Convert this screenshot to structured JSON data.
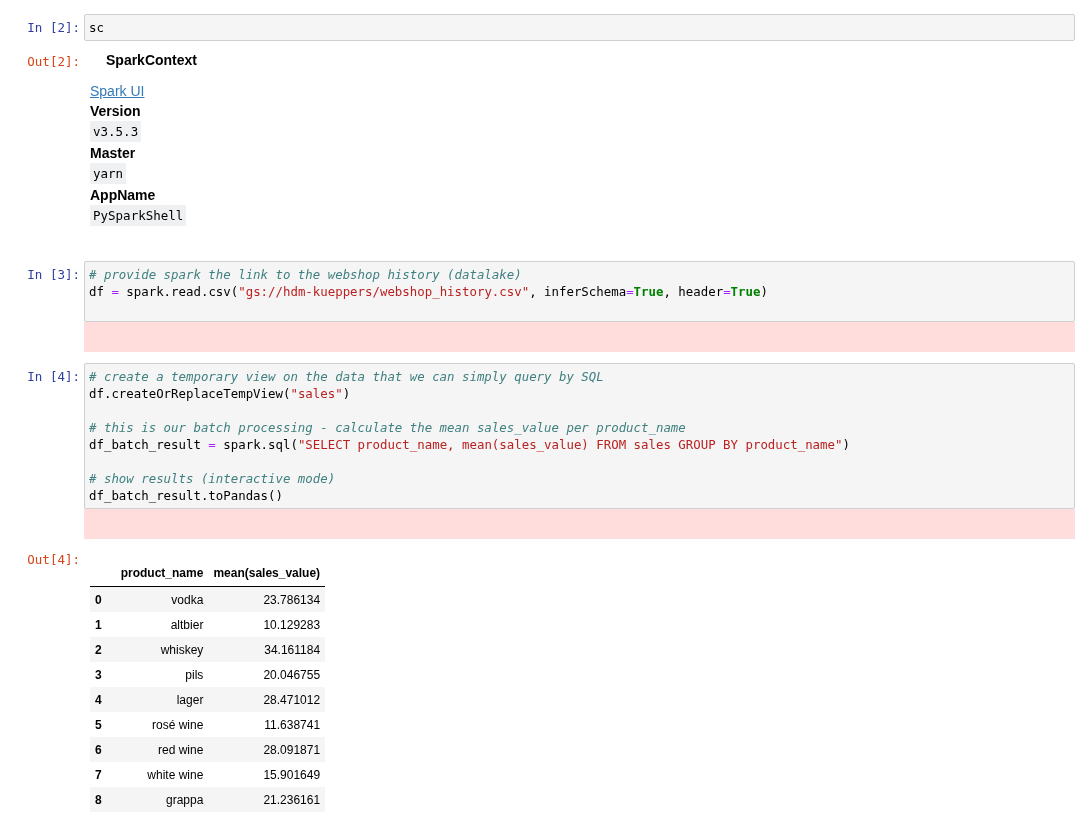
{
  "cells": [
    {
      "kind": "code",
      "prompt": "In [2]:",
      "tokens": [
        {
          "text": "sc",
          "kind": "plain"
        }
      ],
      "trailing_blank": false,
      "stderr": false
    },
    {
      "kind": "spark_context",
      "prompt": "Out[2]:",
      "title": "SparkContext",
      "link": "Spark UI",
      "fields": [
        {
          "label": "Version",
          "value": "v3.5.3"
        },
        {
          "label": "Master",
          "value": "yarn"
        },
        {
          "label": "AppName",
          "value": "PySparkShell"
        }
      ]
    },
    {
      "kind": "code",
      "prompt": "In [3]:",
      "tokens": [
        {
          "text": "# provide spark the link to the webshop history (datalake)",
          "kind": "comment"
        },
        {
          "text": "\ndf ",
          "kind": "plain"
        },
        {
          "text": "=",
          "kind": "op"
        },
        {
          "text": " spark.read.csv(",
          "kind": "plain"
        },
        {
          "text": "\"gs://hdm-kueppers/webshop_history.csv\"",
          "kind": "string"
        },
        {
          "text": ", inferSchema",
          "kind": "plain"
        },
        {
          "text": "=",
          "kind": "op"
        },
        {
          "text": "True",
          "kind": "keyword"
        },
        {
          "text": ", header",
          "kind": "plain"
        },
        {
          "text": "=",
          "kind": "op"
        },
        {
          "text": "True",
          "kind": "keyword"
        },
        {
          "text": ")",
          "kind": "plain"
        }
      ],
      "trailing_blank": true,
      "stderr": true
    },
    {
      "kind": "code",
      "prompt": "In [4]:",
      "tokens": [
        {
          "text": "# create a temporary view on the data that we can simply query by SQL",
          "kind": "comment"
        },
        {
          "text": "\ndf.createOrReplaceTempView(",
          "kind": "plain"
        },
        {
          "text": "\"sales\"",
          "kind": "string"
        },
        {
          "text": ")\n\n",
          "kind": "plain"
        },
        {
          "text": "# this is our batch processing - calculate the mean sales_value per product_name",
          "kind": "comment"
        },
        {
          "text": "\ndf_batch_result ",
          "kind": "plain"
        },
        {
          "text": "=",
          "kind": "op"
        },
        {
          "text": " spark.sql(",
          "kind": "plain"
        },
        {
          "text": "\"SELECT product_name, mean(sales_value) FROM sales GROUP BY product_name\"",
          "kind": "string"
        },
        {
          "text": ")\n\n",
          "kind": "plain"
        },
        {
          "text": "# show results (interactive mode)",
          "kind": "comment"
        },
        {
          "text": "\ndf_batch_result.toPandas()",
          "kind": "plain"
        }
      ],
      "trailing_blank": false,
      "stderr": true
    },
    {
      "kind": "dataframe",
      "prompt": "Out[4]:",
      "columns": [
        "product_name",
        "mean(sales_value)"
      ],
      "rows": [
        {
          "index": "0",
          "cells": [
            "vodka",
            "23.786134"
          ]
        },
        {
          "index": "1",
          "cells": [
            "altbier",
            "10.129283"
          ]
        },
        {
          "index": "2",
          "cells": [
            "whiskey",
            "34.161184"
          ]
        },
        {
          "index": "3",
          "cells": [
            "pils",
            "20.046755"
          ]
        },
        {
          "index": "4",
          "cells": [
            "lager",
            "28.471012"
          ]
        },
        {
          "index": "5",
          "cells": [
            "rosé wine",
            "11.638741"
          ]
        },
        {
          "index": "6",
          "cells": [
            "red wine",
            "28.091871"
          ]
        },
        {
          "index": "7",
          "cells": [
            "white wine",
            "15.901649"
          ]
        },
        {
          "index": "8",
          "cells": [
            "grappa",
            "21.236161"
          ]
        }
      ]
    }
  ]
}
